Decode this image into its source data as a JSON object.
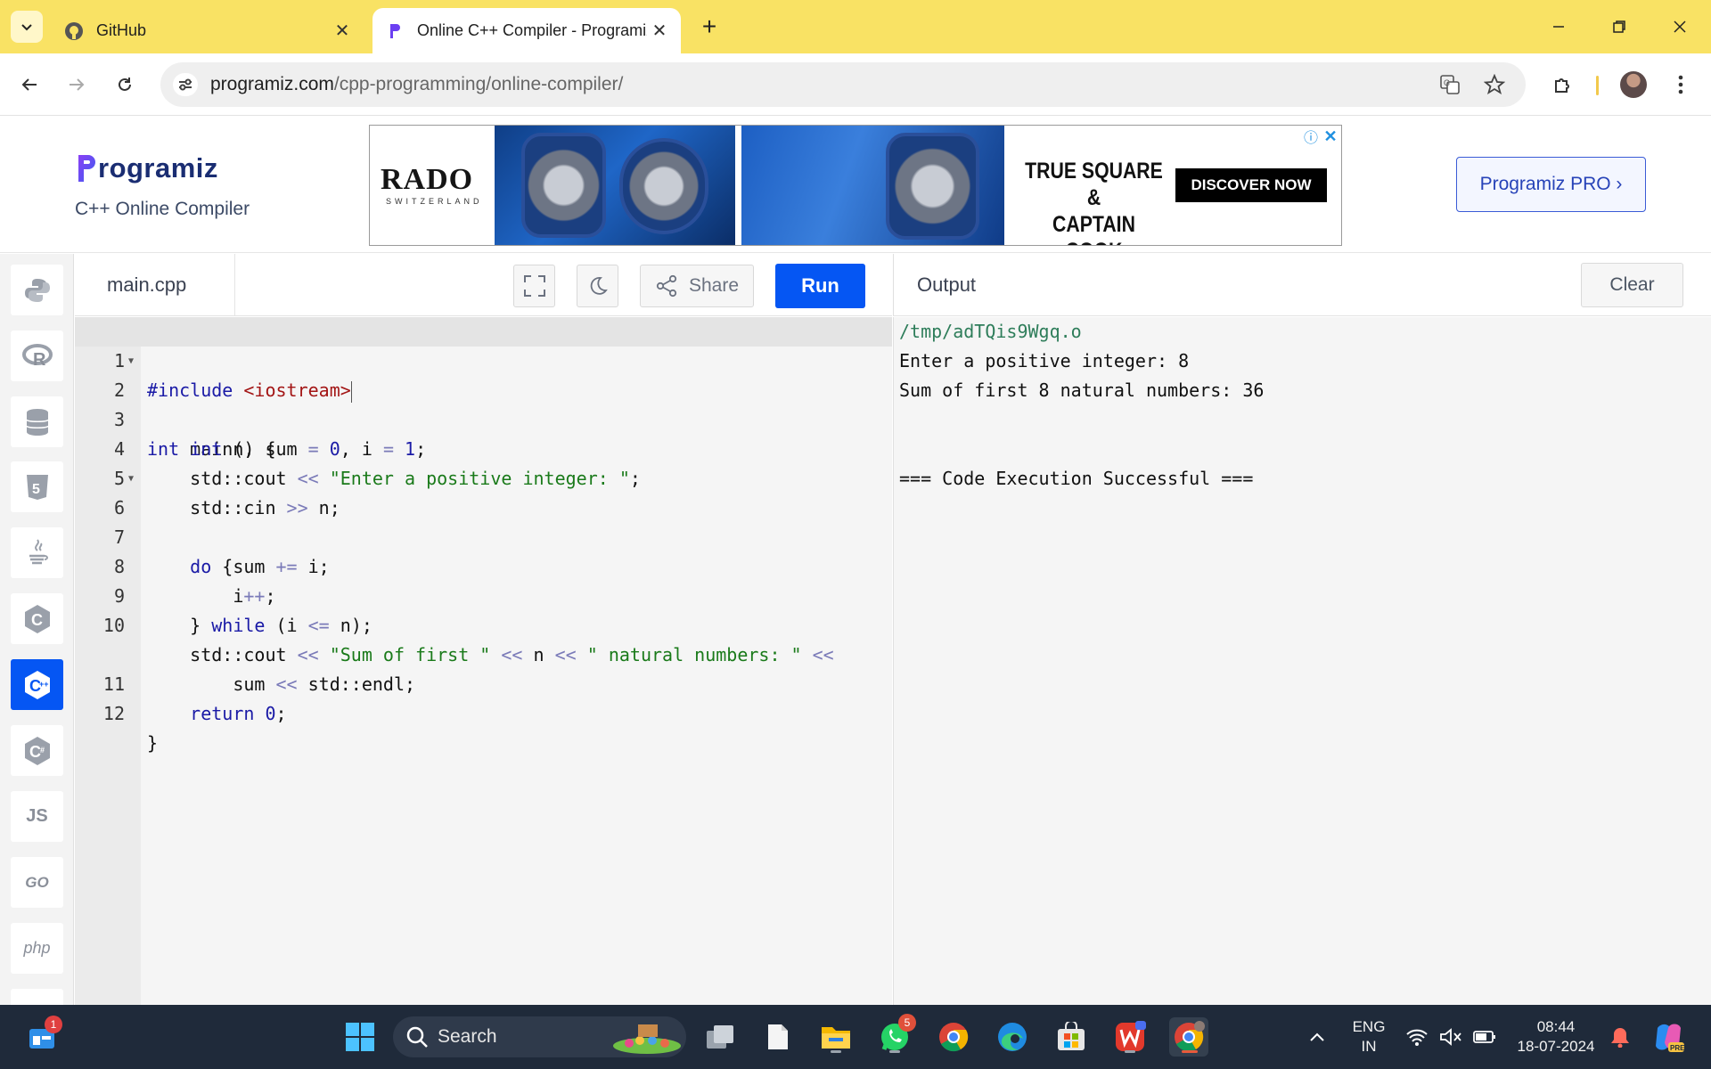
{
  "browser": {
    "tabs": [
      {
        "title": "GitHub",
        "active": false
      },
      {
        "title": "Online C++ Compiler - Programiz",
        "active": true
      }
    ],
    "url_host": "programiz.com",
    "url_path": "/cpp-programming/online-compiler/"
  },
  "site": {
    "logo_text": "Programiz",
    "subtitle": "C++ Online Compiler",
    "pro_button": "Programiz PRO ›"
  },
  "ad": {
    "brand": "RADO",
    "brand_sub": "SWITZERLAND",
    "headline_line1": "TRUE SQUARE &",
    "headline_line2": "CAPTAIN COOK",
    "cta": "DISCOVER NOW",
    "info_icon": "ⓘ",
    "close_icon": "✕"
  },
  "rail": {
    "items": [
      {
        "name": "python",
        "glyph": ""
      },
      {
        "name": "r",
        "glyph": "R"
      },
      {
        "name": "sql",
        "glyph": ""
      },
      {
        "name": "html",
        "glyph": "5"
      },
      {
        "name": "java",
        "glyph": ""
      },
      {
        "name": "c",
        "glyph": "C"
      },
      {
        "name": "cpp",
        "glyph": "C"
      },
      {
        "name": "csharp",
        "glyph": "C"
      },
      {
        "name": "js",
        "glyph": "JS"
      },
      {
        "name": "go",
        "glyph": "GO"
      },
      {
        "name": "php",
        "glyph": "php"
      }
    ],
    "active": "cpp"
  },
  "editor": {
    "filename": "main.cpp",
    "share_label": "Share",
    "run_label": "Run",
    "lines": [
      "#include <iostream>",
      "int main() {",
      "    int n, sum = 0, i = 1;",
      "    std::cout << \"Enter a positive integer: \";",
      "    std::cin >> n;",
      "    do {",
      "        sum += i;",
      "        i++;",
      "    } while (i <= n);",
      "    std::cout << \"Sum of first \" << n << \" natural numbers: \" <<",
      "        sum << std::endl;",
      "    return 0;",
      "}"
    ],
    "line_numbers": [
      "1",
      "2",
      "3",
      "4",
      "5",
      "6",
      "7",
      "8",
      "9",
      "10",
      "",
      "11",
      "12"
    ]
  },
  "output": {
    "title": "Output",
    "clear_label": "Clear",
    "lines": [
      "/tmp/adTQis9Wgq.o",
      "Enter a positive integer: 8",
      "Sum of first 8 natural numbers: 36",
      "",
      "",
      "=== Code Execution Successful ==="
    ]
  },
  "taskbar": {
    "search_label": "Search",
    "widgets_badge": "1",
    "whatsapp_badge": "5",
    "lang_line1": "ENG",
    "lang_line2": "IN",
    "time": "08:44",
    "date": "18-07-2024"
  },
  "colors": {
    "tab_strip": "#f9e264",
    "run_blue": "#0556f3",
    "brand_navy": "#1a2d72",
    "taskbar": "#1f2a3a"
  }
}
